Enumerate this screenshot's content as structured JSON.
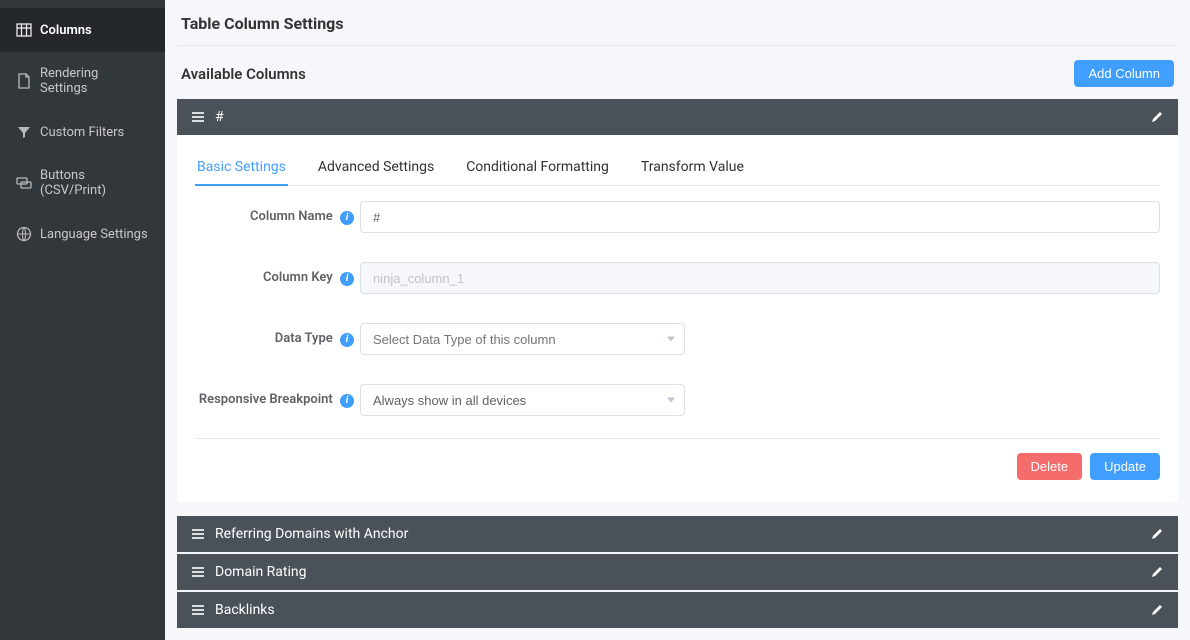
{
  "sidebar": {
    "items": [
      {
        "label": "Columns"
      },
      {
        "label": "Rendering Settings"
      },
      {
        "label": "Custom Filters"
      },
      {
        "label": "Buttons (CSV/Print)"
      },
      {
        "label": "Language Settings"
      }
    ]
  },
  "page_title": "Table Column Settings",
  "section_title": "Available Columns",
  "add_column_label": "Add Column",
  "open_column": {
    "title": "#",
    "tabs": [
      {
        "label": "Basic Settings"
      },
      {
        "label": "Advanced Settings"
      },
      {
        "label": "Conditional Formatting"
      },
      {
        "label": "Transform Value"
      }
    ],
    "fields": {
      "column_name": {
        "label": "Column Name",
        "value": "#"
      },
      "column_key": {
        "label": "Column Key",
        "value": "ninja_column_1"
      },
      "data_type": {
        "label": "Data Type",
        "placeholder": "Select Data Type of this column",
        "value": ""
      },
      "responsive_breakpoint": {
        "label": "Responsive Breakpoint",
        "value": "Always show in all devices"
      }
    },
    "footer": {
      "delete": "Delete",
      "update": "Update"
    }
  },
  "collapsed_columns": [
    {
      "title": "Referring Domains with Anchor"
    },
    {
      "title": "Domain Rating"
    },
    {
      "title": "Backlinks"
    }
  ]
}
